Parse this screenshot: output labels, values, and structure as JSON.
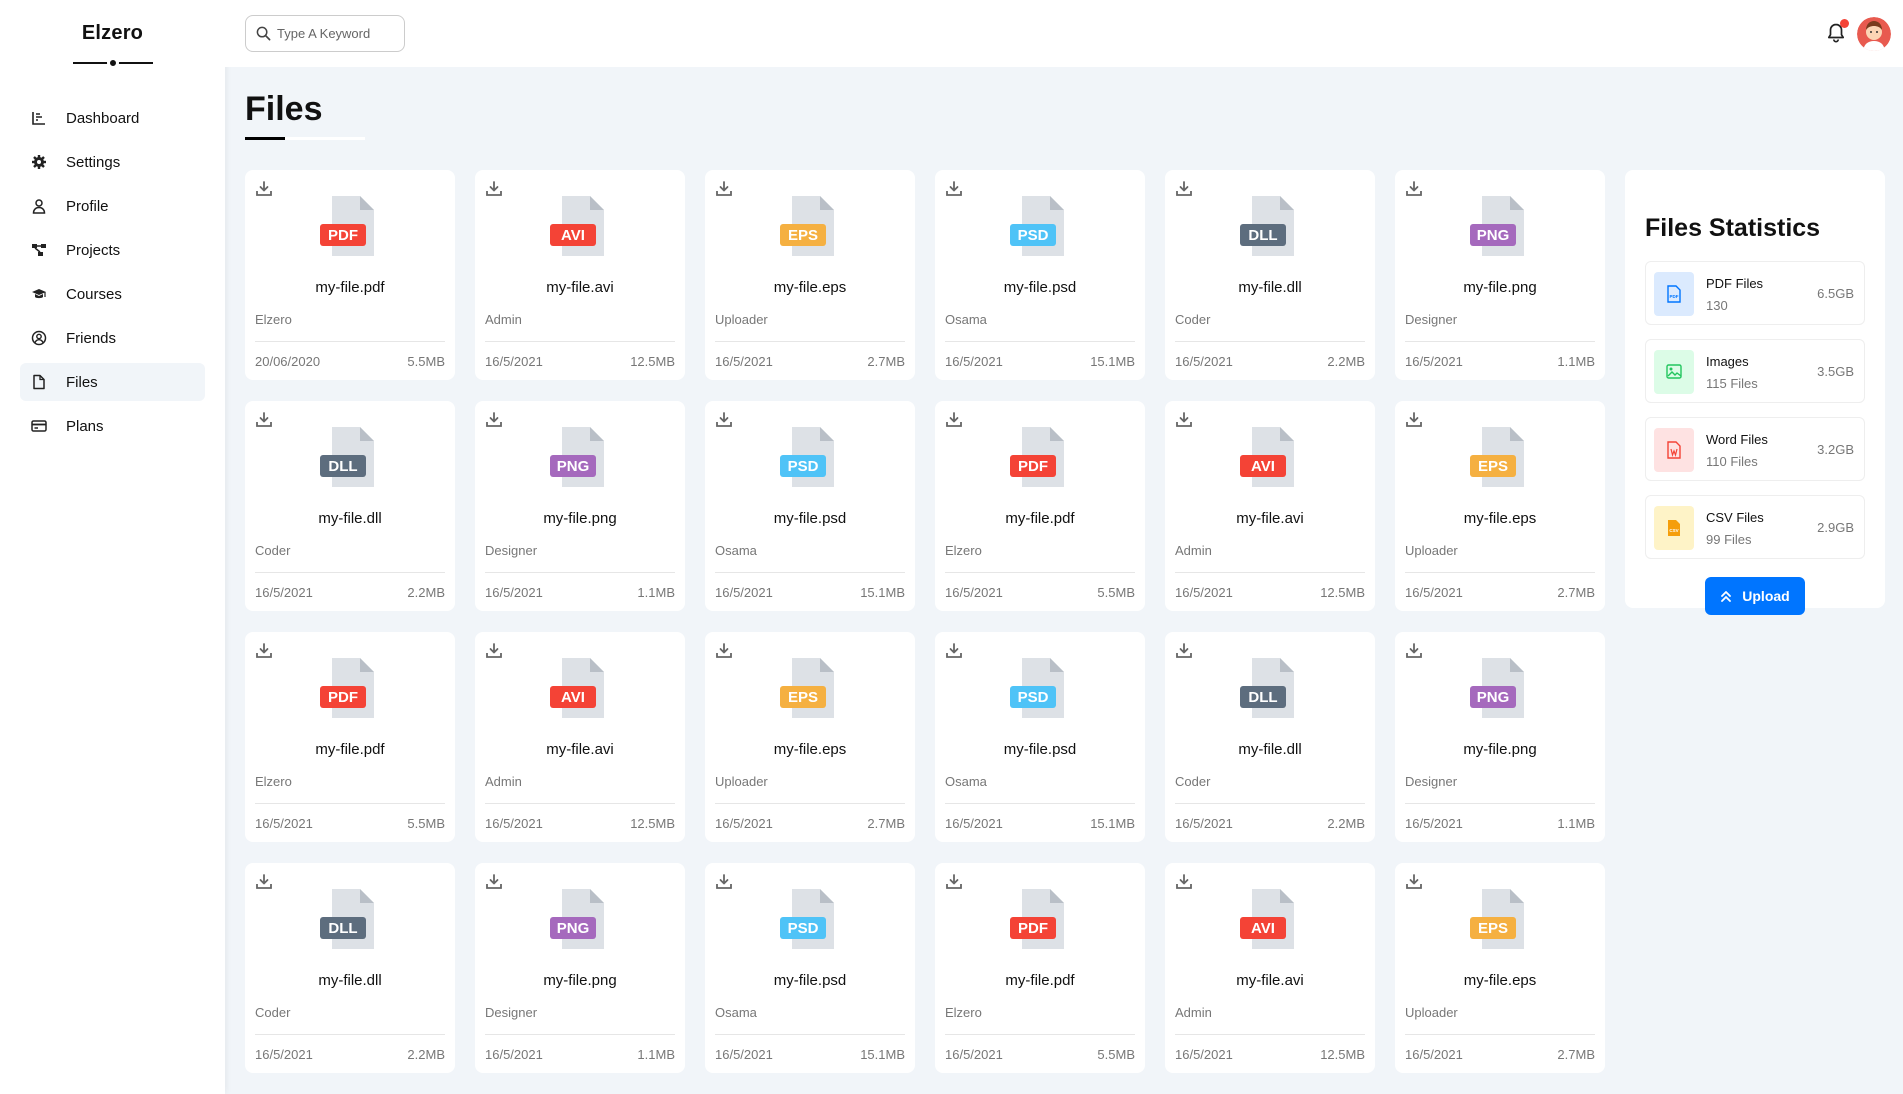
{
  "brand": "Elzero",
  "nav": [
    {
      "label": "Dashboard",
      "icon": "chart-line-icon",
      "active": false
    },
    {
      "label": "Settings",
      "icon": "gear-icon",
      "active": false
    },
    {
      "label": "Profile",
      "icon": "user-icon",
      "active": false
    },
    {
      "label": "Projects",
      "icon": "diagram-project-icon",
      "active": false
    },
    {
      "label": "Courses",
      "icon": "graduation-cap-icon",
      "active": false
    },
    {
      "label": "Friends",
      "icon": "user-circle-icon",
      "active": false
    },
    {
      "label": "Files",
      "icon": "file-icon",
      "active": true
    },
    {
      "label": "Plans",
      "icon": "credit-card-icon",
      "active": false
    }
  ],
  "search": {
    "placeholder": "Type A Keyword"
  },
  "page_title": "Files",
  "files": [
    {
      "ext": "PDF",
      "name": "my-file.pdf",
      "uploader": "Elzero",
      "date": "20/06/2020",
      "size": "5.5MB"
    },
    {
      "ext": "AVI",
      "name": "my-file.avi",
      "uploader": "Admin",
      "date": "16/5/2021",
      "size": "12.5MB"
    },
    {
      "ext": "EPS",
      "name": "my-file.eps",
      "uploader": "Uploader",
      "date": "16/5/2021",
      "size": "2.7MB"
    },
    {
      "ext": "PSD",
      "name": "my-file.psd",
      "uploader": "Osama",
      "date": "16/5/2021",
      "size": "15.1MB"
    },
    {
      "ext": "DLL",
      "name": "my-file.dll",
      "uploader": "Coder",
      "date": "16/5/2021",
      "size": "2.2MB"
    },
    {
      "ext": "PNG",
      "name": "my-file.png",
      "uploader": "Designer",
      "date": "16/5/2021",
      "size": "1.1MB"
    },
    {
      "ext": "DLL",
      "name": "my-file.dll",
      "uploader": "Coder",
      "date": "16/5/2021",
      "size": "2.2MB"
    },
    {
      "ext": "PNG",
      "name": "my-file.png",
      "uploader": "Designer",
      "date": "16/5/2021",
      "size": "1.1MB"
    },
    {
      "ext": "PSD",
      "name": "my-file.psd",
      "uploader": "Osama",
      "date": "16/5/2021",
      "size": "15.1MB"
    },
    {
      "ext": "PDF",
      "name": "my-file.pdf",
      "uploader": "Elzero",
      "date": "16/5/2021",
      "size": "5.5MB"
    },
    {
      "ext": "AVI",
      "name": "my-file.avi",
      "uploader": "Admin",
      "date": "16/5/2021",
      "size": "12.5MB"
    },
    {
      "ext": "EPS",
      "name": "my-file.eps",
      "uploader": "Uploader",
      "date": "16/5/2021",
      "size": "2.7MB"
    },
    {
      "ext": "PDF",
      "name": "my-file.pdf",
      "uploader": "Elzero",
      "date": "16/5/2021",
      "size": "5.5MB"
    },
    {
      "ext": "AVI",
      "name": "my-file.avi",
      "uploader": "Admin",
      "date": "16/5/2021",
      "size": "12.5MB"
    },
    {
      "ext": "EPS",
      "name": "my-file.eps",
      "uploader": "Uploader",
      "date": "16/5/2021",
      "size": "2.7MB"
    },
    {
      "ext": "PSD",
      "name": "my-file.psd",
      "uploader": "Osama",
      "date": "16/5/2021",
      "size": "15.1MB"
    },
    {
      "ext": "DLL",
      "name": "my-file.dll",
      "uploader": "Coder",
      "date": "16/5/2021",
      "size": "2.2MB"
    },
    {
      "ext": "PNG",
      "name": "my-file.png",
      "uploader": "Designer",
      "date": "16/5/2021",
      "size": "1.1MB"
    },
    {
      "ext": "DLL",
      "name": "my-file.dll",
      "uploader": "Coder",
      "date": "16/5/2021",
      "size": "2.2MB"
    },
    {
      "ext": "PNG",
      "name": "my-file.png",
      "uploader": "Designer",
      "date": "16/5/2021",
      "size": "1.1MB"
    },
    {
      "ext": "PSD",
      "name": "my-file.psd",
      "uploader": "Osama",
      "date": "16/5/2021",
      "size": "15.1MB"
    },
    {
      "ext": "PDF",
      "name": "my-file.pdf",
      "uploader": "Elzero",
      "date": "16/5/2021",
      "size": "5.5MB"
    },
    {
      "ext": "AVI",
      "name": "my-file.avi",
      "uploader": "Admin",
      "date": "16/5/2021",
      "size": "12.5MB"
    },
    {
      "ext": "EPS",
      "name": "my-file.eps",
      "uploader": "Uploader",
      "date": "16/5/2021",
      "size": "2.7MB"
    }
  ],
  "ext_colors": {
    "PDF": "#f44336",
    "AVI": "#f44336",
    "EPS": "#f5b041",
    "PSD": "#4fc3f7",
    "DLL": "#5d6d7e",
    "PNG": "#a569bd"
  },
  "stats": {
    "title": "Files Statistics",
    "items": [
      {
        "name": "PDF Files",
        "count": "130",
        "size": "6.5GB",
        "icon": "pdf-file-icon",
        "color": "#0075ff",
        "bg": "#dbeafe"
      },
      {
        "name": "Images",
        "count": "115 Files",
        "size": "3.5GB",
        "icon": "image-icon",
        "color": "#22c55e",
        "bg": "#dcfce7"
      },
      {
        "name": "Word Files",
        "count": "110 Files",
        "size": "3.2GB",
        "icon": "word-file-icon",
        "color": "#f44336",
        "bg": "#fee2e2"
      },
      {
        "name": "CSV Files",
        "count": "99 Files",
        "size": "2.9GB",
        "icon": "csv-file-icon",
        "color": "#f59e0b",
        "bg": "#fef3c7"
      }
    ],
    "upload_label": "Upload"
  }
}
